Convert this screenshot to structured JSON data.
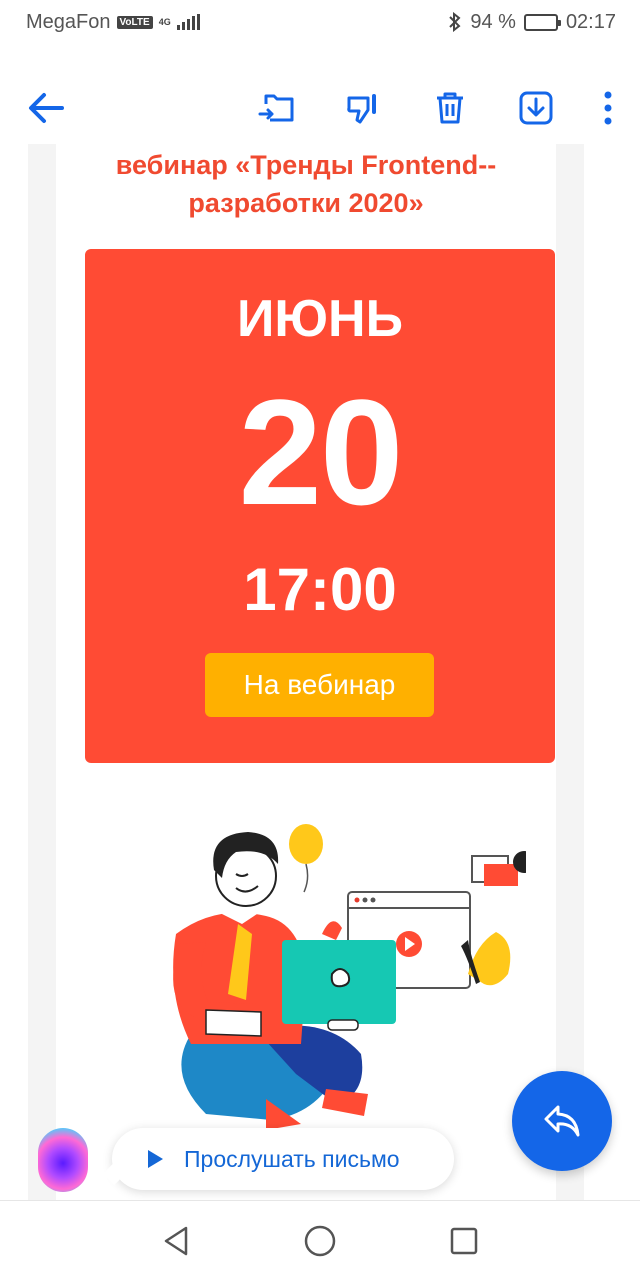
{
  "status_bar": {
    "carrier": "MegaFon",
    "volte": "VoLTE",
    "network": "4G",
    "battery_percent": "94 %",
    "battery_level": 0.94,
    "time": "02:17"
  },
  "toolbar": {
    "back_icon": "arrow-left-icon",
    "actions": [
      "move-to-folder-icon",
      "spam-icon",
      "delete-icon",
      "save-icon",
      "more-icon"
    ]
  },
  "email": {
    "headline": "вебинар «Тренды Frontend-- разработки 2020»",
    "month": "ИЮНЬ",
    "day": "20",
    "time": "17:00",
    "cta": "На вебинар"
  },
  "listen": {
    "label": "Прослушать письмо",
    "icon": "play-icon"
  },
  "reply_fab_icon": "reply-icon",
  "nav": [
    "back-triangle-icon",
    "home-circle-icon",
    "recents-square-icon"
  ],
  "colors": {
    "accent_blue": "#1466e8",
    "card_red": "#ff4b34",
    "cta_yellow": "#ffb000",
    "headline_red": "#f04a30"
  }
}
